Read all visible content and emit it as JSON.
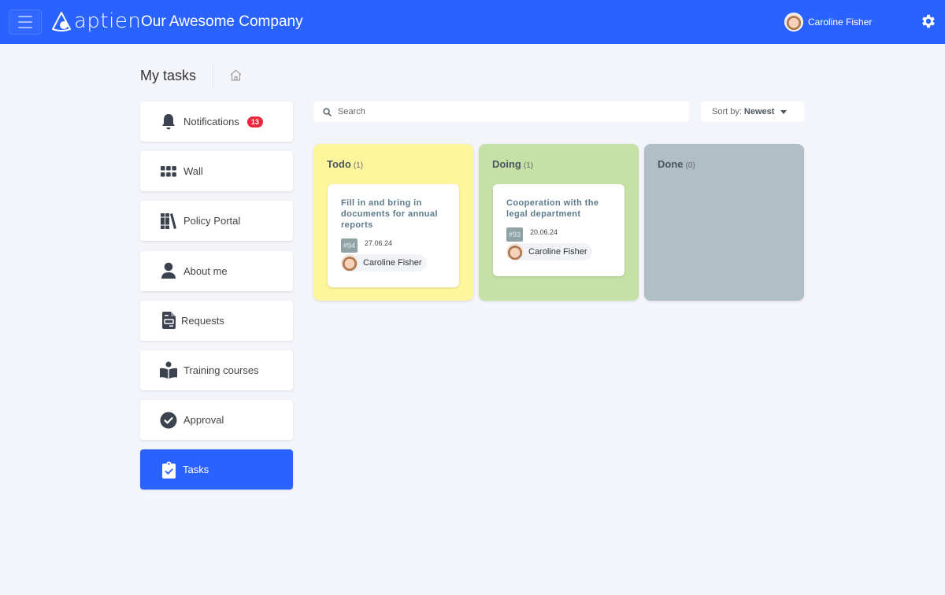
{
  "header": {
    "logo_text": "aptien",
    "company_name": "Our Awesome Company",
    "user_name": "Caroline Fisher",
    "brand_color": "#2962ff"
  },
  "page": {
    "title": "My tasks"
  },
  "sidebar": {
    "items": [
      {
        "label": "Notifications",
        "icon": "bell-icon",
        "badge": "13"
      },
      {
        "label": "Wall",
        "icon": "grid-icon"
      },
      {
        "label": "Policy Portal",
        "icon": "books-icon"
      },
      {
        "label": "About me",
        "icon": "user-icon"
      },
      {
        "label": "Requests",
        "icon": "document-icon"
      },
      {
        "label": "Training courses",
        "icon": "reading-person-icon"
      },
      {
        "label": "Approval",
        "icon": "check-circle-icon"
      },
      {
        "label": "Tasks",
        "icon": "clipboard-check-icon",
        "active": true
      }
    ]
  },
  "toolbar": {
    "search_placeholder": "Search",
    "sort_prefix": "Sort by:",
    "sort_value": "Newest"
  },
  "board": {
    "columns": [
      {
        "name": "Todo",
        "count": "(1)",
        "color": "#fff59c",
        "cards": [
          {
            "title": "Fill in and bring in documents for annual reports",
            "id": "#94",
            "date": "27.06.24",
            "assignee": "Caroline Fisher"
          }
        ]
      },
      {
        "name": "Doing",
        "count": "(1)",
        "color": "#c5e1a5",
        "cards": [
          {
            "title": "Cooperation with the legal department",
            "id": "#93",
            "date": "20.06.24",
            "assignee": "Caroline Fisher"
          }
        ]
      },
      {
        "name": "Done",
        "count": "(0)",
        "color": "#b0bec5",
        "cards": []
      }
    ]
  }
}
